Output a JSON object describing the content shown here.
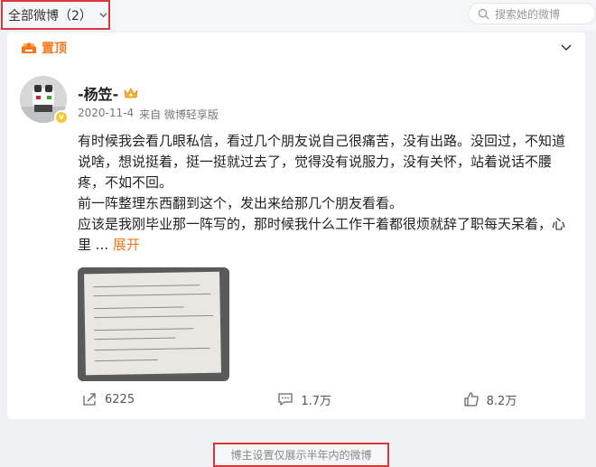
{
  "filter": {
    "label": "全部微博（2）",
    "icon": "chevron-down-icon"
  },
  "search": {
    "placeholder": "搜索她的微博",
    "icon": "search-icon"
  },
  "post": {
    "pinned_label": "置顶",
    "author": "-杨笠-",
    "date": "2020-11-4",
    "source": "来自 微博轻享版",
    "paragraphs": [
      "有时候我会看几眼私信，看过几个朋友说自己很痛苦，没有出路。没回过，不知道说啥，想说挺着，挺一挺就过去了，觉得没有说服力，没有关怀，站着说话不腰疼，不如不回。",
      "前一阵整理东西翻到这个，发出来给那几个朋友看看。",
      "应该是我刚毕业那一阵写的，那时候我什么工作干着都很烦就辞了职每天呆着，心里"
    ],
    "ellipsis": " ... ",
    "expand_label": "展开",
    "image_alt": "handwritten note photo",
    "actions": {
      "repost_count": "6225",
      "comment_count": "1.7万",
      "like_count": "8.2万"
    },
    "verified_badge": "v"
  },
  "notice": {
    "text": "博主设置仅展示半年内的微博"
  },
  "colors": {
    "accent": "#f2771c",
    "highlight_border": "#d9383a",
    "background": "#eff1f4"
  }
}
